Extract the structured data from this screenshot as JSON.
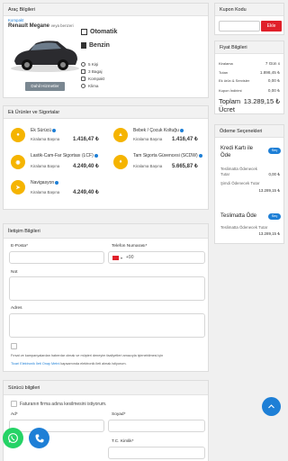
{
  "vehicle_card": {
    "title": "Araç Bilgileri",
    "category": "Kompakt",
    "model": "Renault Megane",
    "model_suffix": "veya benzeri",
    "transmission": "Otomatik",
    "fuel": "Benzin",
    "specs": [
      "5 Kişi",
      "3 Bagaj",
      "Kompakt",
      "Klima"
    ],
    "button": "Dahil Hizmetler"
  },
  "coupon_card": {
    "title": "Kupon Kodu",
    "placeholder": "",
    "button": "Ekle"
  },
  "price_card": {
    "title": "Fiyat Bilgileri",
    "rows": [
      {
        "label": "Kiralama",
        "value": "7 Gün x"
      },
      {
        "label": "Tutarı",
        "value": "1.898,45 ₺"
      },
      {
        "label": "Ek ürün & Servisler",
        "value": "0,00 ₺"
      },
      {
        "label": "Kupon İndirimi",
        "value": "0,00 ₺"
      }
    ],
    "total_label": "Toplam Ücret",
    "total_value": "13.289,15 ₺"
  },
  "payment_card": {
    "title": "Ödeme Seçenekleri",
    "option1": {
      "label": "Kredi Kartı ile Öde",
      "toggle": "Seç"
    },
    "pay_later_label": "Teslimatta Ödenecek Tutar",
    "pay_later_value": "0,00 ₺",
    "pay_now_label": "Şimdi Ödenecek Tutar",
    "pay_now_value": "13.289,15 ₺",
    "option2": {
      "label": "Teslimatta Öde",
      "toggle": "Seç"
    },
    "option2_sub_label": "Teslimatta Ödenecek Tutar",
    "option2_sub_value": "13.289,15 ₺"
  },
  "extras_card": {
    "title": "Ek Ürünler ve Sigortalar",
    "price_label": "Kiralama Başına",
    "items": [
      {
        "name": "Ek Sürücü",
        "price": "1.416,47 ₺"
      },
      {
        "name": "Bebek / Çocuk Koltuğu",
        "price": "1.416,47 ₺"
      },
      {
        "name": "Lastik-Cam-Far Sigortası (LCF)",
        "price": "4.249,40 ₺"
      },
      {
        "name": "Tam Sigorta Güvencesi (SCDW)",
        "price": "5.665,87 ₺"
      },
      {
        "name": "Navigasyon",
        "price": "4.249,40 ₺"
      }
    ]
  },
  "contact_card": {
    "title": "İletişim Bilgileri",
    "email_label": "E-Posta*",
    "phone_label": "Telefon Numarası*",
    "phone_code": "+90",
    "note_label": "Not",
    "address_label": "Adres",
    "consent_text": "Fırsat ve kampanyalardan haberdar olmak ve müşteri deneyim faaliyetleri amacıyla işlenebilmesi için",
    "consent_link": "Ticari Elektronik İleti Onay Metni",
    "consent_suffix": "kapsamında elektronik ileti almak istiyorum."
  },
  "driver_card": {
    "title": "Sürücü bilgileri",
    "invoice_label": "Faturanın firma adına kesilmesini istiyorum.",
    "name_label": "Ad*",
    "surname_label": "Soyad*",
    "tc_label": "T.C. Kimlik*"
  },
  "colors": {
    "accent": "#1e7fd6",
    "danger": "#e0202a",
    "gold": "#f5b400",
    "whatsapp": "#25d366"
  }
}
